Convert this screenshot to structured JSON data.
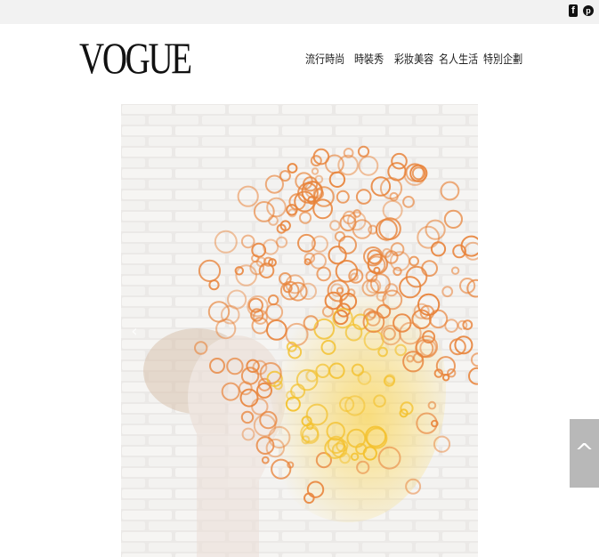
{
  "topbar": {
    "social": [
      {
        "icon": "facebook-icon",
        "glyph": "f"
      },
      {
        "icon": "pinterest-icon",
        "glyph": "p"
      }
    ]
  },
  "header": {
    "logo": "VOGUE",
    "nav": [
      "流行時尚",
      "時裝秀",
      "彩妝美容",
      "名人生活",
      "特別企劃"
    ]
  },
  "hero": {
    "image": "woman-blowing-bubbles-brick-wall",
    "prev_icon": "‹",
    "next_icon": "›"
  },
  "back_to_top": {
    "icon": "^"
  },
  "colors": {
    "topbar_bg": "#f2f2f2",
    "back_to_top_bg": "#b8b8b8",
    "bubble_orange": "#e8833a",
    "bubble_yellow": "#f3c12e"
  }
}
